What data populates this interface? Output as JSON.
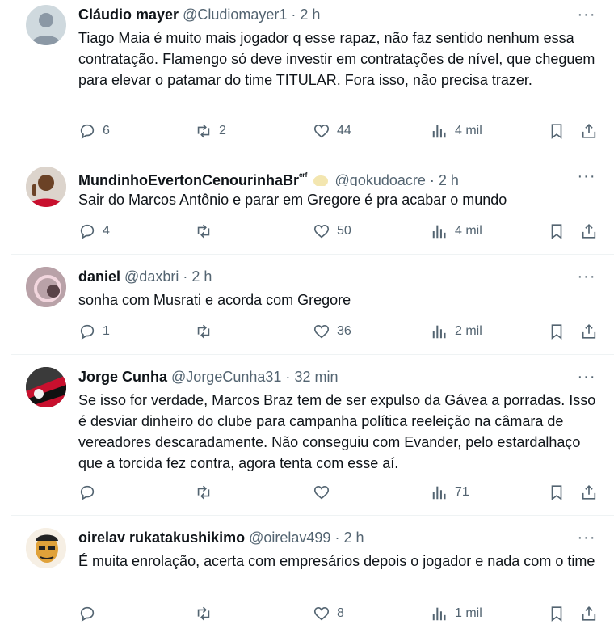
{
  "more_label": "···",
  "replies": [
    {
      "name": "Cláudio mayer",
      "handle": "@Cludiomayer1",
      "dot": "·",
      "time": "2 h",
      "text": "Tiago Maia é muito mais jogador q esse rapaz, não faz sentido nenhum essa contratação. Flamengo só deve investir em contratações de nível, que cheguem para elevar o patamar do time TITULAR. Fora isso, não precisa trazer.",
      "replies_count": "6",
      "reposts_count": "2",
      "likes_count": "44",
      "views_count": "4 mil"
    },
    {
      "name": "MundinhoEvertonCenourinhaBr",
      "name_suffix": "ᶜʳᶠ",
      "handle": "@gokudoacre",
      "dot": "·",
      "time": "2 h",
      "text": "Sair do Marcos Antônio e parar em Gregore é pra acabar o mundo",
      "replies_count": "4",
      "reposts_count": "",
      "likes_count": "50",
      "views_count": "4 mil"
    },
    {
      "name": "daniel",
      "handle": "@daxbri",
      "dot": "·",
      "time": "2 h",
      "text": "sonha com Musrati e acorda com Gregore",
      "replies_count": "1",
      "reposts_count": "",
      "likes_count": "36",
      "views_count": "2 mil"
    },
    {
      "name": "Jorge Cunha",
      "handle": "@JorgeCunha31",
      "dot": "·",
      "time": "32 min",
      "text": "Se isso for verdade, Marcos Braz tem de ser expulso da Gávea a porradas. Isso é desviar dinheiro do clube para campanha política reeleição na câmara de vereadores descaradamente. Não conseguiu com Evander, pelo estardalhaço que a torcida fez contra, agora tenta com esse aí.",
      "replies_count": "",
      "reposts_count": "",
      "likes_count": "",
      "views_count": "71"
    },
    {
      "name": "oirelav rukatakushikimo",
      "handle": "@oirelav499",
      "dot": "·",
      "time": "2 h",
      "text": "É muita enrolação,  acerta com empresários depois o jogador e nada com o time",
      "replies_count": "",
      "reposts_count": "",
      "likes_count": "8",
      "views_count": "1 mil"
    }
  ]
}
